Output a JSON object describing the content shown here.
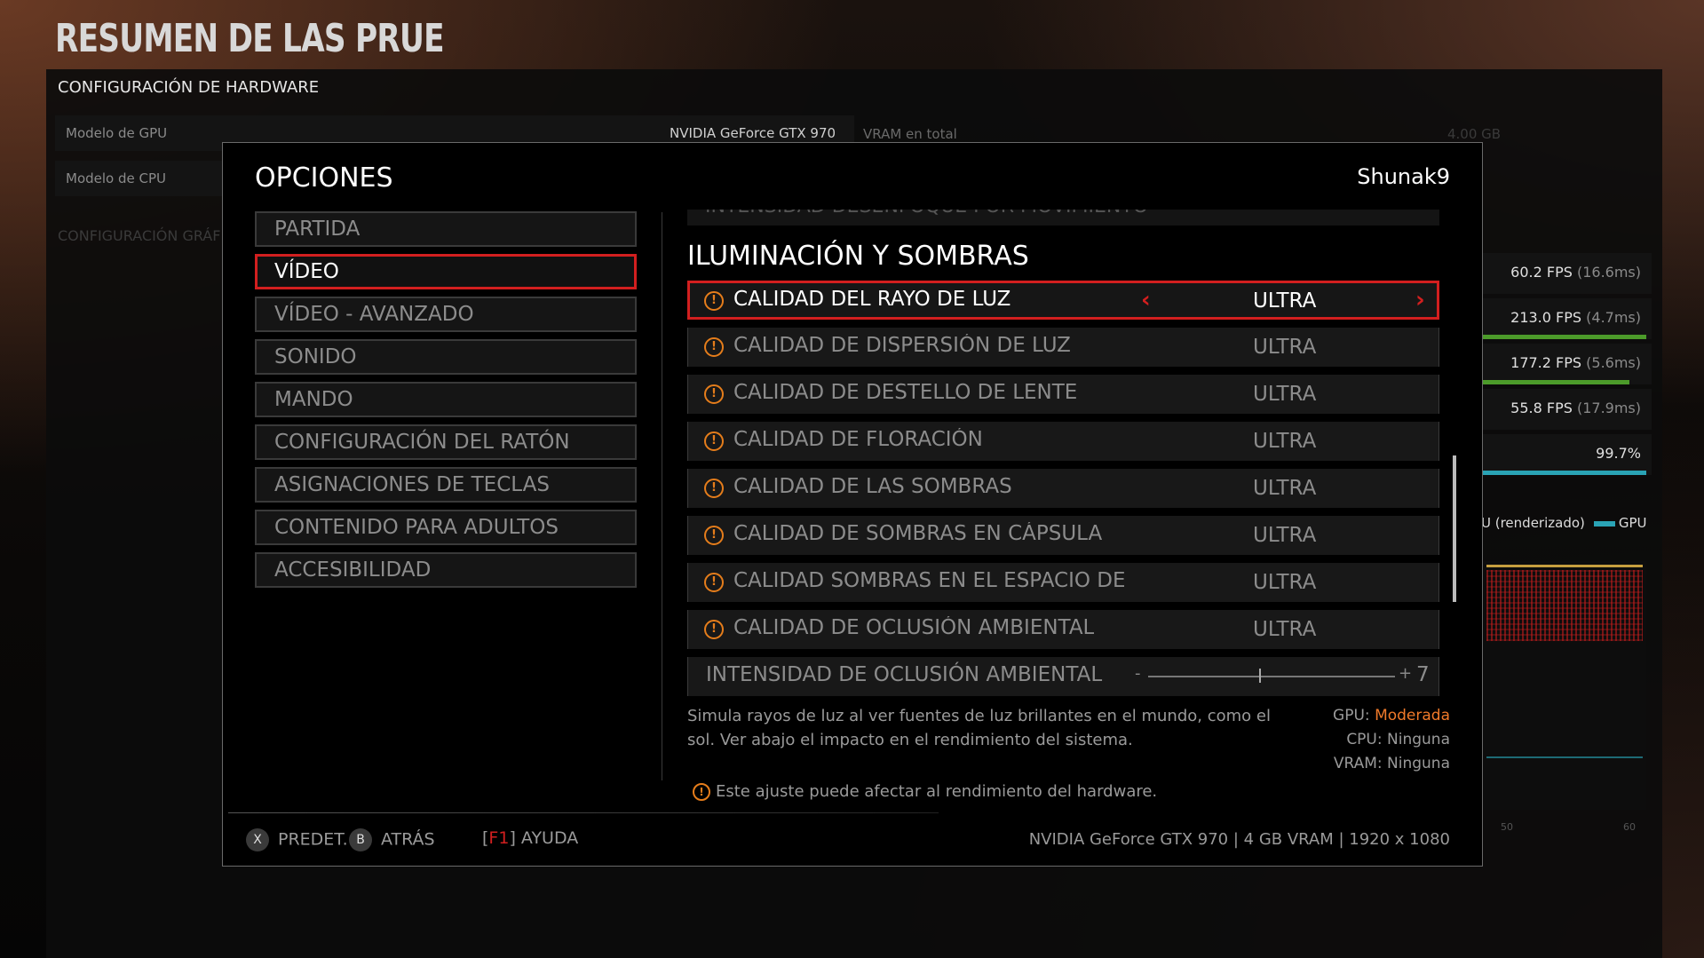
{
  "background": {
    "title": "RESUMEN DE LAS PRUE",
    "hardware_section": "CONFIGURACIÓN DE HARDWARE",
    "gpu_label": "Modelo de GPU",
    "gpu_value": "NVIDIA GeForce GTX 970",
    "vram_label": "VRAM en total",
    "vram_value": "4.00 GB",
    "cpu_label": "Modelo de CPU",
    "graphics_section": "CONFIGURACIÓN GRÁF",
    "fps": [
      {
        "value": "60.2 FPS",
        "ms": "(16.6ms)"
      },
      {
        "value": "213.0 FPS",
        "ms": "(4.7ms)"
      },
      {
        "value": "177.2 FPS",
        "ms": "(5.6ms)"
      },
      {
        "value": "55.8 FPS",
        "ms": "(17.9ms)"
      },
      {
        "value": "99.7%",
        "ms": ""
      }
    ],
    "legend": {
      "partial": "U (renderizado)",
      "gpu": "GPU"
    },
    "graph_axis": [
      "50",
      "60"
    ]
  },
  "modal": {
    "title": "OPCIONES",
    "user": "Shunak9",
    "menu": [
      {
        "label": "PARTIDA"
      },
      {
        "label": "VÍDEO"
      },
      {
        "label": "VÍDEO - AVANZADO"
      },
      {
        "label": "SONIDO"
      },
      {
        "label": "MANDO"
      },
      {
        "label": "CONFIGURACIÓN DEL RATÓN"
      },
      {
        "label": "ASIGNACIONES DE TECLAS"
      },
      {
        "label": "CONTENIDO PARA ADULTOS"
      },
      {
        "label": "ACCESIBILIDAD"
      }
    ],
    "active_menu": "VÍDEO",
    "clipped_row": "INTENSIDAD DESENFOQUE POR MOVIMIENTO",
    "section_heading": "ILUMINACIÓN Y SOMBRAS",
    "options": [
      {
        "label": "CALIDAD DEL RAYO DE LUZ",
        "value": "ULTRA"
      },
      {
        "label": "CALIDAD DE DISPERSIÓN DE LUZ",
        "value": "ULTRA"
      },
      {
        "label": "CALIDAD DE DESTELLO DE LENTE",
        "value": "ULTRA"
      },
      {
        "label": "CALIDAD DE FLORACIÓN",
        "value": "ULTRA"
      },
      {
        "label": "CALIDAD DE LAS SOMBRAS",
        "value": "ULTRA"
      },
      {
        "label": "CALIDAD DE SOMBRAS EN CÁPSULA",
        "value": "ULTRA"
      },
      {
        "label": "CALIDAD SOMBRAS EN EL ESPACIO DE PAN",
        "value": "ULTRA"
      },
      {
        "label": "CALIDAD DE OCLUSIÓN AMBIENTAL",
        "value": "ULTRA"
      }
    ],
    "slider": {
      "label": "INTENSIDAD DE OCLUSIÓN AMBIENTAL",
      "minus": "-",
      "plus": "+",
      "value": "7",
      "level": 0.45
    },
    "description": "Simula rayos de luz al ver fuentes de luz brillantes en el mundo, como el sol. Ver abajo el impacto en el rendimiento del sistema.",
    "impact": {
      "gpu_label": "GPU:",
      "gpu_value": "Moderada",
      "cpu_label": "CPU:",
      "cpu_value": "Ninguna",
      "vram_label": "VRAM:",
      "vram_value": "Ninguna"
    },
    "warning_note": "Este ajuste puede afectar al rendimiento del hardware.",
    "footer": {
      "default_key": "X",
      "default_label": "PREDET.",
      "back_key": "B",
      "back_label": "ATRÁS",
      "help_key_open": "[",
      "help_key": "F1",
      "help_key_close": "]",
      "help_label": "AYUDA",
      "system_info": "NVIDIA GeForce GTX 970 | 4 GB VRAM | 1920 x 1080"
    }
  },
  "colors": {
    "accent": "#d21f1f",
    "warning": "#e57d1b",
    "moderate": "#f07a2a"
  }
}
